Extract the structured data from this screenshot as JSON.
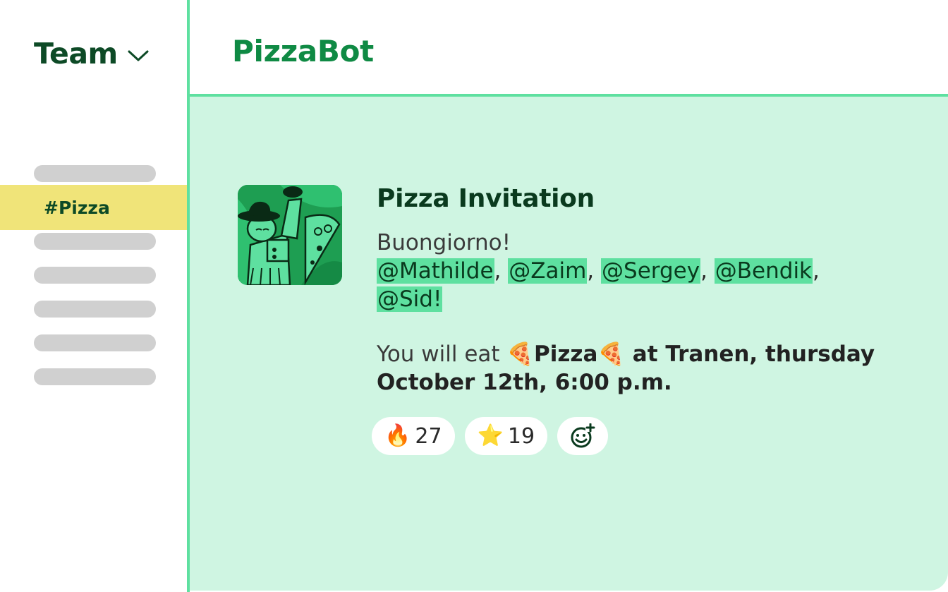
{
  "sidebar": {
    "team_label": "Team",
    "active_channel": "#Pizza"
  },
  "header": {
    "title": "PizzaBot"
  },
  "message": {
    "title": "Pizza Invitation",
    "greeting": "Buongiorno!",
    "mentions": [
      "@Mathilde",
      "@Zaim",
      "@Sergey",
      "@Bendik",
      "@Sid!"
    ],
    "event_prefix": "You will eat ",
    "pizza_emoji": "🍕",
    "pizza_word": "Pizza",
    "event_details": " at Tranen, thursday October 12th, 6:00 p.m."
  },
  "reactions": [
    {
      "emoji": "🔥",
      "count": "27"
    },
    {
      "emoji": "⭐",
      "count": "19"
    }
  ],
  "colors": {
    "accent": "#5ee0a0",
    "dark_green": "#0d4a26",
    "brand_green": "#0f8a44",
    "message_bg": "#cff5e2",
    "active_channel_bg": "#f0e479"
  }
}
